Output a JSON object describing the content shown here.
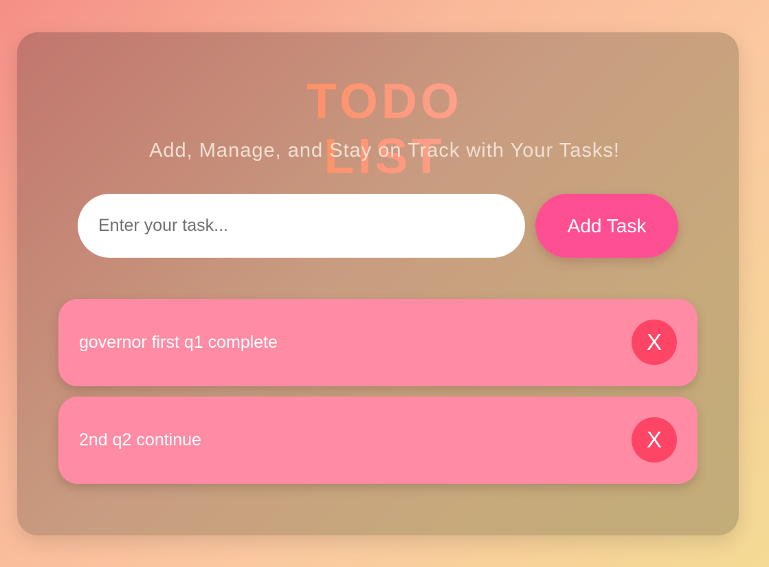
{
  "header": {
    "title": "TODO LIST",
    "subtitle": "Add, Manage, and Stay on Track with Your Tasks!"
  },
  "form": {
    "input_value": "",
    "input_placeholder": "Enter your task...",
    "add_label": "Add Task"
  },
  "tasks": [
    {
      "text": "governor first q1 complete",
      "delete_label": "X"
    },
    {
      "text": "2nd q2 continue",
      "delete_label": "X"
    }
  ],
  "colors": {
    "add_button": "#ff4f93",
    "task_item": "#ff8ba4",
    "delete_button": "#ff4565",
    "title_gradient_start": "#ff8a50",
    "title_gradient_end": "#ffa79a"
  }
}
